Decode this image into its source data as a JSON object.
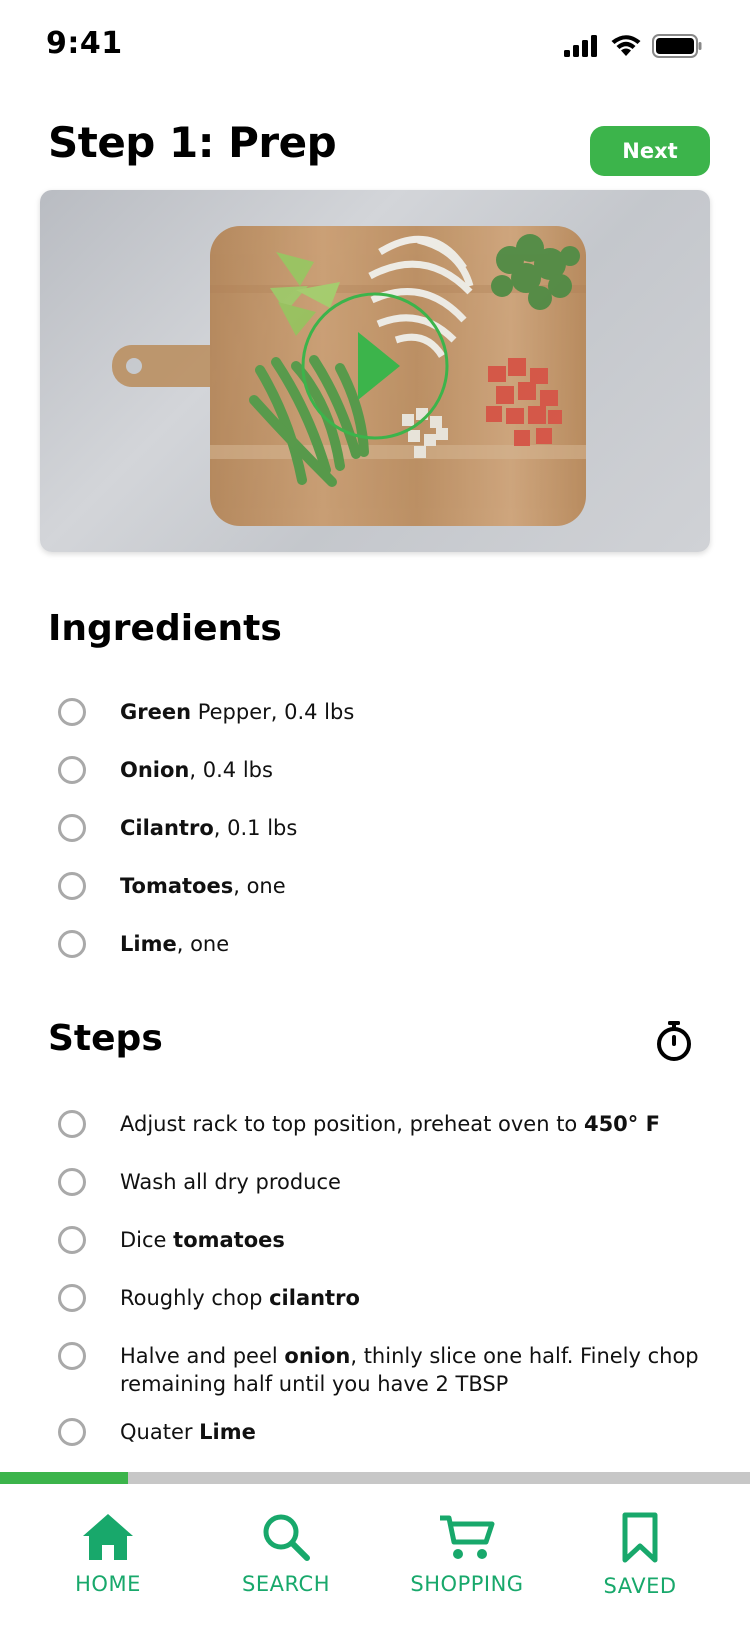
{
  "status_bar": {
    "time": "9:41"
  },
  "header": {
    "title": "Step 1: Prep",
    "next_label": "Next"
  },
  "video": {
    "play_icon": "play-icon"
  },
  "ingredients": {
    "title": "Ingredients",
    "items": [
      {
        "bold": "Green",
        "rest": " Pepper, 0.4 lbs"
      },
      {
        "bold": "Onion",
        "rest": ", 0.4 lbs"
      },
      {
        "bold": "Cilantro",
        "rest": ", 0.1 lbs"
      },
      {
        "bold": "Tomatoes",
        "rest": ", one"
      },
      {
        "bold": "Lime",
        "rest": ", one"
      }
    ]
  },
  "steps": {
    "title": "Steps",
    "timer_icon": "stopwatch-icon",
    "items": [
      {
        "pre": "Adjust rack to top position, preheat oven to ",
        "bold": "450° F",
        "post": ""
      },
      {
        "pre": "Wash all dry produce",
        "bold": "",
        "post": ""
      },
      {
        "pre": "Dice ",
        "bold": "tomatoes",
        "post": ""
      },
      {
        "pre": "Roughly chop ",
        "bold": "cilantro",
        "post": ""
      },
      {
        "pre": "Halve and peel ",
        "bold": "onion",
        "post": ", thinly slice one half. Finely chop remaining half until you have 2 TBSP"
      },
      {
        "pre": "Quater ",
        "bold": "Lime",
        "post": ""
      }
    ]
  },
  "progress": {
    "fraction": 0.17
  },
  "tabs": [
    {
      "label": "HOME",
      "icon": "home-icon"
    },
    {
      "label": "SEARCH",
      "icon": "search-icon"
    },
    {
      "label": "SHOPPING",
      "icon": "cart-icon"
    },
    {
      "label": "SAVED",
      "icon": "bookmark-icon"
    }
  ],
  "colors": {
    "accent": "#3cb44b",
    "tab": "#18a86b",
    "circle": "#a9a9a9"
  }
}
